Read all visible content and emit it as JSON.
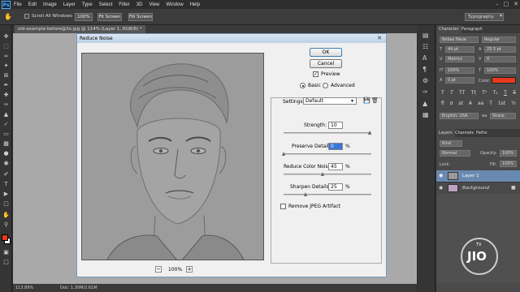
{
  "menubar": {
    "logo": "Ps",
    "items": [
      "File",
      "Edit",
      "Image",
      "Layer",
      "Type",
      "Select",
      "Filter",
      "3D",
      "View",
      "Window",
      "Help"
    ]
  },
  "options": {
    "scroll_all_windows": "Scroll All Windows",
    "zoom_100": "100%",
    "fit_screen": "Fit Screen",
    "fill_screen": "Fill Screen",
    "workspace": "Typography"
  },
  "document": {
    "tab_label": "old-example-before@3x.jpg @ 114% (Layer 1, RGB/8) *"
  },
  "status": {
    "zoom": "113.89%",
    "doc_size": "Doc: 1.30M/2.61M"
  },
  "dialog": {
    "title": "Reduce Noise",
    "ok": "OK",
    "cancel": "Cancel",
    "preview_label": "Preview",
    "preview_checked": true,
    "mode_basic": "Basic",
    "mode_advanced": "Advanced",
    "mode_selected": "Basic",
    "settings_label": "Settings:",
    "settings_value": "Default",
    "strength_label": "Strength:",
    "strength_value": "10",
    "strength_max": 10,
    "preserve_label": "Preserve Details:",
    "preserve_value": "0",
    "preserve_unit": "%",
    "color_noise_label": "Reduce Color Noise:",
    "color_noise_value": "45",
    "color_noise_unit": "%",
    "sharpen_label": "Sharpen Details:",
    "sharpen_value": "25",
    "sharpen_unit": "%",
    "jpeg_label": "Remove JPEG Artifact",
    "jpeg_checked": false,
    "zoom_level": "100%"
  },
  "character_panel": {
    "tab_character": "Character",
    "tab_paragraph": "Paragraph",
    "font_family": "Bebas Neue",
    "font_style": "Regular",
    "font_size": "44 pt",
    "leading": "25.5 pt",
    "kerning": "Metrics",
    "tracking": "0",
    "scale_v": "100%",
    "scale_h": "100%",
    "baseline": "0 pt",
    "color_label": "Color:",
    "color_value": "#e8391c",
    "language": "English: USA",
    "antialias": "Sharp"
  },
  "layers_panel": {
    "tab_layers": "Layers",
    "tab_channels": "Channels",
    "tab_paths": "Paths",
    "filter_kind": "Kind",
    "blend_mode": "Normal",
    "opacity_label": "Opacity:",
    "opacity_value": "100%",
    "lock_label": "Lock:",
    "fill_label": "Fill:",
    "fill_value": "100%",
    "layers": [
      {
        "name": "Layer 1",
        "selected": true
      },
      {
        "name": "Background",
        "selected": false
      }
    ]
  },
  "watermark": {
    "text": "JIO",
    "subtext": "TV"
  }
}
